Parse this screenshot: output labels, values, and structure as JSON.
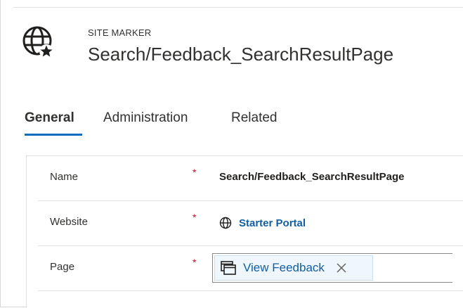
{
  "header": {
    "icon": "globe-marker-icon",
    "entity_type": "SITE MARKER",
    "record_title": "Search/Feedback_SearchResultPage"
  },
  "tabs": [
    {
      "label": "General",
      "active": true
    },
    {
      "label": "Administration",
      "active": false
    },
    {
      "label": "Related",
      "active": false
    }
  ],
  "form": {
    "required_marker": "*",
    "name": {
      "label": "Name",
      "value": "Search/Feedback_SearchResultPage"
    },
    "website": {
      "label": "Website",
      "icon": "globe-icon",
      "value": "Starter Portal"
    },
    "page": {
      "label": "Page",
      "icon": "web-page-icon",
      "value": "View Feedback",
      "remove_icon": "close-icon"
    }
  },
  "colors": {
    "accent": "#0f6cbd",
    "link": "#115ea3",
    "required": "#c50f1f",
    "tag_background": "#eff6fc"
  }
}
